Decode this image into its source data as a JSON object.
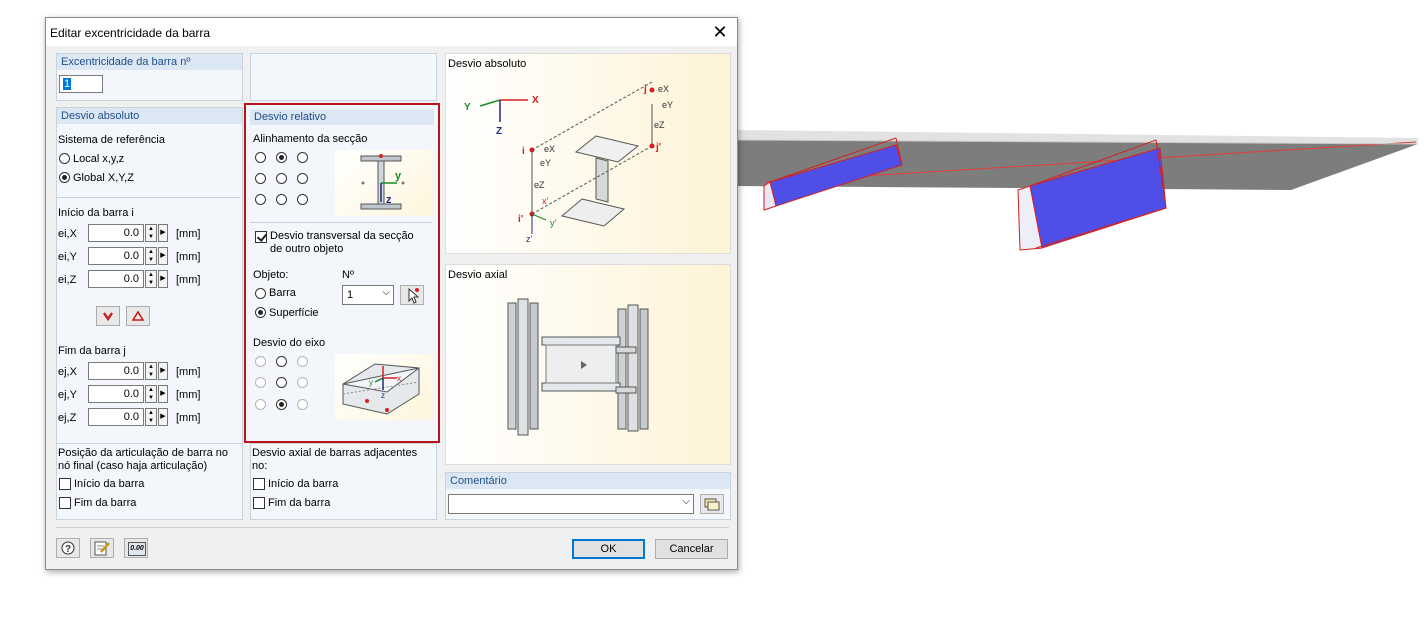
{
  "dialog": {
    "title": "Editar excentricidade da barra",
    "close_glyph": "✕"
  },
  "member_no": {
    "header": "Excentricidade da barra nº",
    "value": "1"
  },
  "absolute_offset": {
    "header": "Desvio absoluto",
    "ref_system_label": "Sistema de referência",
    "options": [
      "Local x,y,z",
      "Global X,Y,Z"
    ],
    "selected": "Global X,Y,Z",
    "start_label": "Início da barra i",
    "start_rows": [
      {
        "label": "ei,X",
        "value": "0.0",
        "unit": "[mm]"
      },
      {
        "label": "ei,Y",
        "value": "0.0",
        "unit": "[mm]"
      },
      {
        "label": "ei,Z",
        "value": "0.0",
        "unit": "[mm]"
      }
    ],
    "end_label": "Fim da barra j",
    "end_rows": [
      {
        "label": "ej,X",
        "value": "0.0",
        "unit": "[mm]"
      },
      {
        "label": "ej,Y",
        "value": "0.0",
        "unit": "[mm]"
      },
      {
        "label": "ej,Z",
        "value": "0.0",
        "unit": "[mm]"
      }
    ]
  },
  "hinge_position": {
    "label": "Posição da articulação de barra no nó final (caso haja articulação)",
    "line1": "Posição da articulação de barra no",
    "line2": "nó final (caso haja articulação)",
    "start": "Início da barra",
    "end": "Fim da barra"
  },
  "relative_offset": {
    "header": "Desvio relativo",
    "alignment_label": "Alinhamento da secção",
    "alignment_selected": "top-center",
    "transverse_checked": true,
    "transverse_line1": "Desvio transversal da secção",
    "transverse_line2": "de outro objeto",
    "object_label": "Objeto:",
    "no_label": "Nº",
    "object_options": [
      "Barra",
      "Superfície"
    ],
    "object_selected": "Superfície",
    "no_value": "1",
    "axis_offset_label": "Desvio do eixo",
    "axis_selected": "bottom-center"
  },
  "axial_adjacent": {
    "line1": "Desvio axial de barras adjacentes",
    "line2": "no:",
    "start": "Início da barra",
    "end": "Fim da barra"
  },
  "preview": {
    "absolute_title": "Desvio absoluto",
    "axial_title": "Desvio axial",
    "labels": {
      "Y": "Y",
      "X": "X",
      "Z": "Z",
      "i": "i",
      "j": "j",
      "i_prime": "i'",
      "j_prime": "j'",
      "ex": "eX",
      "ey": "eY",
      "ez": "eZ",
      "ex2": "eX",
      "ey2": "eY",
      "ez2": "eZ",
      "x_prime": "x'",
      "y_prime": "y'",
      "z_prime": "z'"
    }
  },
  "comment": {
    "header": "Comentário",
    "value": ""
  },
  "footer": {
    "ok": "OK",
    "cancel": "Cancelar",
    "calc_icon_text": "0.00"
  },
  "colors": {
    "highlight_border": "#b8141b",
    "panel_header": "#dbe7f3",
    "member_fill": "#4d4dff"
  }
}
